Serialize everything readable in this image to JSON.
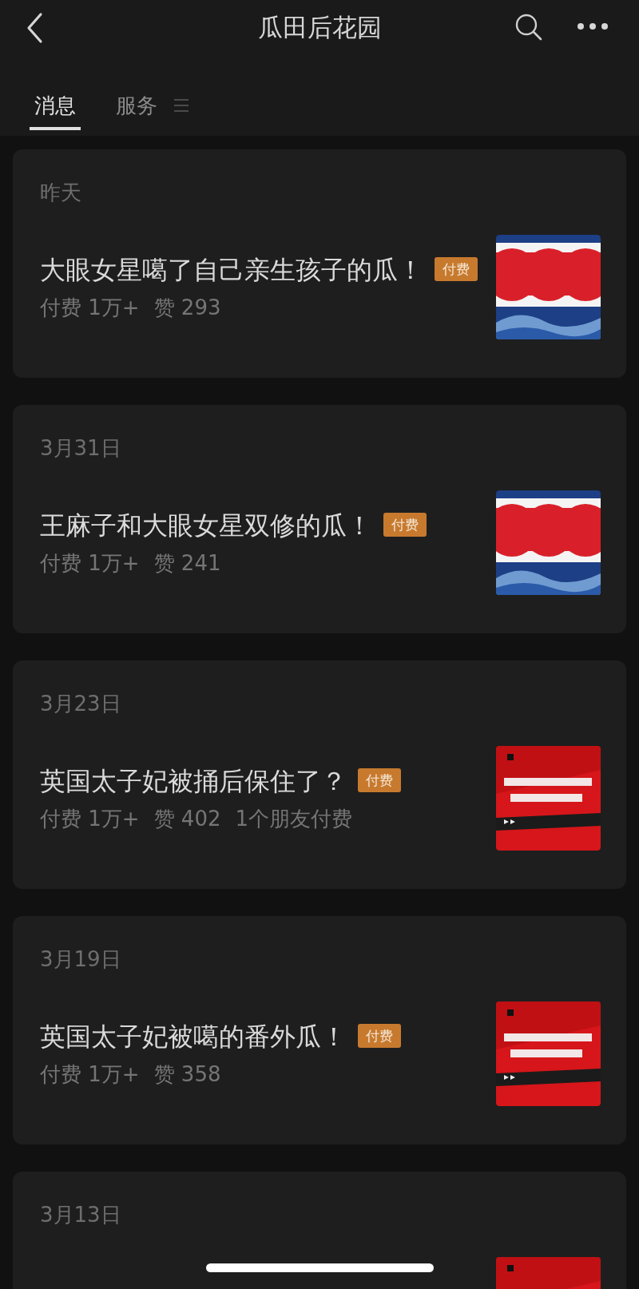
{
  "header": {
    "title": "瓜田后花园"
  },
  "tabs": [
    {
      "label": "消息",
      "selected": true
    },
    {
      "label": "服务",
      "selected": false,
      "menu": true
    }
  ],
  "messages": [
    {
      "date": "昨天",
      "title": "大眼女星噶了自己亲生孩子的瓜！",
      "badge": "付费",
      "meta": [
        "付费 1万+",
        "赞 293"
      ],
      "thumbnail": {
        "kind": "picture"
      }
    },
    {
      "date": "3月31日",
      "title": "王麻子和大眼女星双修的瓜！",
      "badge": "付费",
      "meta": [
        "付费 1万+",
        "赞 241"
      ],
      "thumbnail": {
        "kind": "picture"
      }
    },
    {
      "date": "3月23日",
      "title": "英国太子妃被捅后保住了？",
      "badge": "付费",
      "meta": [
        "付费 1万+",
        "赞 402",
        "1个朋友付费"
      ],
      "thumbnail": {
        "kind": "picture"
      }
    },
    {
      "date": "3月19日",
      "title": "英国太子妃被噶的番外瓜！",
      "badge": "付费",
      "meta": [
        "付费 1万+",
        "赞 358"
      ],
      "thumbnail": {
        "kind": "picture"
      }
    },
    {
      "date": "3月13日",
      "thumbnail": {
        "kind": "picture"
      }
    }
  ]
}
